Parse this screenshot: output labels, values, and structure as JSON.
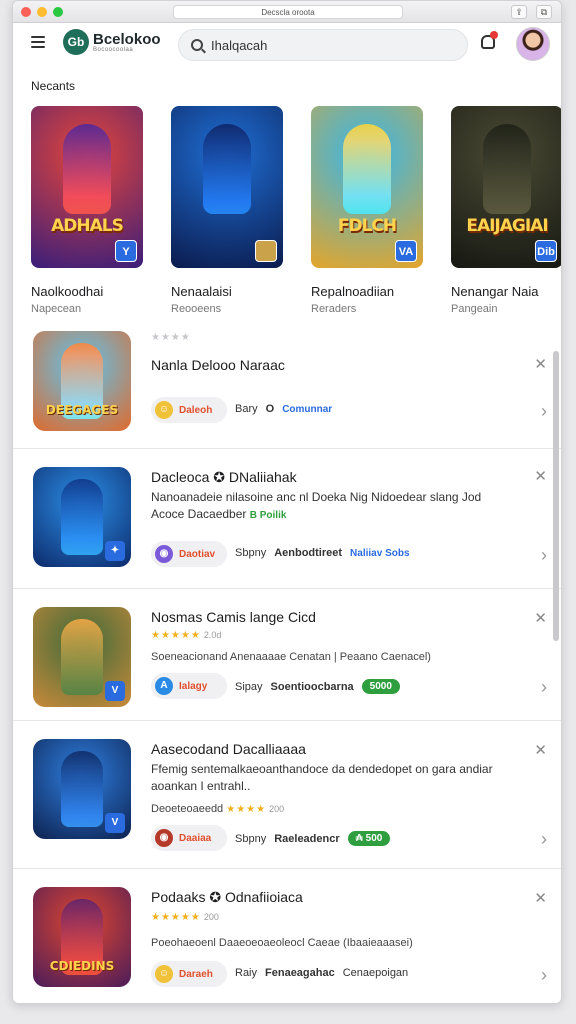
{
  "window": {
    "address": "Decscla oroota"
  },
  "header": {
    "logo_initials": "Gb",
    "logo_title": "Bcelokoo",
    "logo_sub": "Bocoocoolaa",
    "search_value": "Ihalqacah"
  },
  "recents": {
    "title": "Necants",
    "cards": [
      {
        "title": "Naolkoodhai",
        "subtitle": "Napecean",
        "art": "ADHALS",
        "badge": "Y",
        "c1": "#e5453a",
        "c2": "#3a1e7a"
      },
      {
        "title": "Nenaalaisi",
        "subtitle": "Reooeens",
        "art": "",
        "badge": "",
        "c1": "#1f6fd6",
        "c2": "#0b1b4d"
      },
      {
        "title": "Repalnoadiian",
        "subtitle": "Reraders",
        "art": "FDLCH",
        "badge": "VA",
        "c1": "#35b7ec",
        "c2": "#e4a52a"
      },
      {
        "title": "Nenangar Naia",
        "subtitle": "Pangeain",
        "art": "EAIJAGIAI",
        "badge": "Dib",
        "c1": "#4b4a34",
        "c2": "#161812"
      }
    ]
  },
  "list": [
    {
      "title": "Nanla Delooo Naraac",
      "desc": "",
      "rating_stars": "★★★★",
      "rating_text": "",
      "pill": "Daleoh",
      "pill_icon": "☺",
      "meta1": "Bary",
      "meta2": "O",
      "meta3": "Comunnar",
      "meta3_type": "link",
      "thumb_text": "DEEGAGES",
      "c1": "#5cc4ef",
      "c2": "#e06a2c",
      "tag": ""
    },
    {
      "title": "Dacleoca ✪ DNaliiahak",
      "desc": "Nanoanadeie nilasoine anc nl Doeka Nig Nidoedear slang Jod Acoce Dacaedber",
      "desc_highlight": "B Poilik",
      "rating_stars": "",
      "rating_text": "",
      "pill": "Daotiav",
      "pill_icon": "◉",
      "meta1": "Sbpny",
      "meta2": "Aenbodtireet",
      "meta3": "Naliiav Sobs",
      "meta3_type": "link",
      "thumb_text": "",
      "c1": "#2b8fe6",
      "c2": "#0d2a6b",
      "tag": "✦"
    },
    {
      "title": "Nosmas Camis lange Cicd",
      "desc": "",
      "rating_stars": "★★★★★",
      "rating_text": "2.0d",
      "pill": "Ialagy",
      "pill_icon": "A",
      "meta1": "Sipay",
      "meta2": "Soentioocbarna",
      "meta3": "5000",
      "meta3_type": "green",
      "sub": "Soeneacionand Anenaaaae Cenatan | Peaano Caenacel)",
      "thumb_text": "",
      "c1": "#3d6a3a",
      "c2": "#c98a3a",
      "tag": "V"
    },
    {
      "title": "Aasecodand Dacalliaaaa",
      "desc": "Ffemig sentemalkaeoanthandoce da dendedopet on gara andiar aoankan I entrahl..",
      "rating_stars": "★★★★",
      "rating_text": "200",
      "pill": "Daaiaa",
      "pill_icon": "◉",
      "meta1": "Sbpny",
      "meta2": "Raeleadencr",
      "meta3": "₳ 500",
      "meta3_type": "green",
      "sub": "Deoeteoaeedd",
      "thumb_text": "",
      "c1": "#2f7fe0",
      "c2": "#0d2250",
      "tag": "V"
    },
    {
      "title": "Podaaks ✪ Odnafiioiaca",
      "desc": "",
      "rating_stars": "★★★★★",
      "rating_text": "200",
      "pill": "Daraeh",
      "pill_icon": "☺",
      "meta1": "Raiy",
      "meta2": "Fenaeagahac",
      "meta3": "Cenaepoigan",
      "meta3_type": "plain",
      "sub": "Poeohaeoenl Daaeoeoaeoleocl Caeae (Ibaaieaaasei)",
      "thumb_text": "CDIEDINS",
      "c1": "#e0462e",
      "c2": "#4a1c5a",
      "tag": ""
    }
  ]
}
